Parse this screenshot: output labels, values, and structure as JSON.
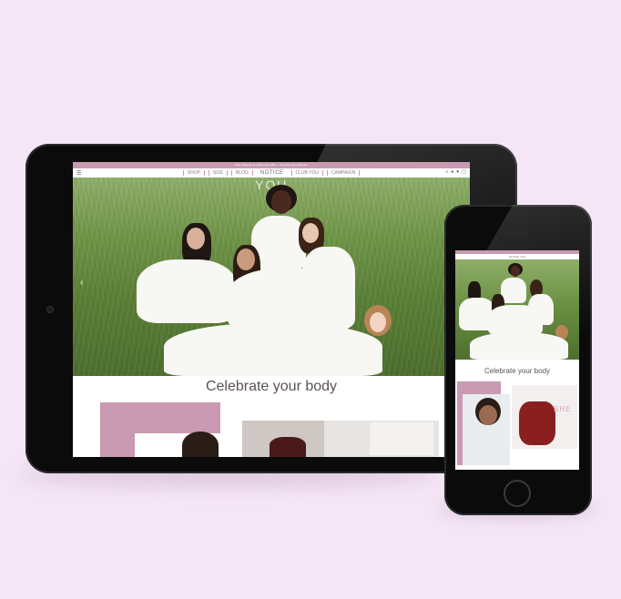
{
  "brand": {
    "accent": "#c99ab1",
    "background": "#f5e6f6"
  },
  "tablet": {
    "promo_text": "Free shipping on orders over $50 — shop the new collection",
    "nav": {
      "menu_icon": "hamburger-icon",
      "items": [
        "SHOP",
        "SIZE",
        "BLOG",
        "CLUB YOU",
        "CAMPAIGN"
      ],
      "logo": "NOTICE",
      "icons": [
        "search-icon",
        "user-icon",
        "heart-icon",
        "cart-icon"
      ]
    },
    "hero": {
      "overlay_text": "YOU",
      "arrow_icon": "chevron-left-icon"
    },
    "headline": "Celebrate your body"
  },
  "phone": {
    "logo": "NOTICE YOU",
    "headline": "Celebrate your body",
    "tile_text": "SHE"
  }
}
